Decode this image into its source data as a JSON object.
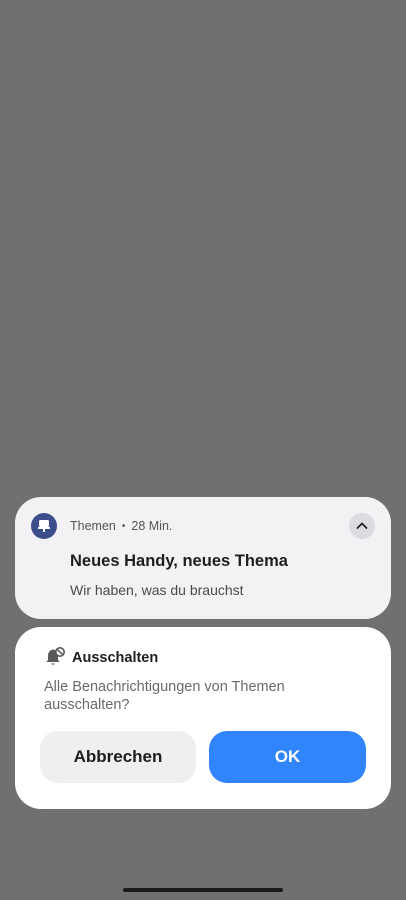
{
  "notification": {
    "app_name": "Themen",
    "separator": "•",
    "time": "28 Min.",
    "title": "Neues Handy, neues Thema",
    "text": "Wir haben, was du brauchst",
    "app_icon": "themes-brush-icon",
    "expand_icon": "chevron-up-icon"
  },
  "dialog": {
    "icon": "bell-off-icon",
    "title": "Ausschalten",
    "message": "Alle Benachrichtigungen von Themen ausschalten?",
    "cancel_label": "Abbrechen",
    "ok_label": "OK"
  },
  "colors": {
    "backdrop": "#707070",
    "accent": "#3185fc",
    "app_icon_bg": "#3d4e8c"
  }
}
